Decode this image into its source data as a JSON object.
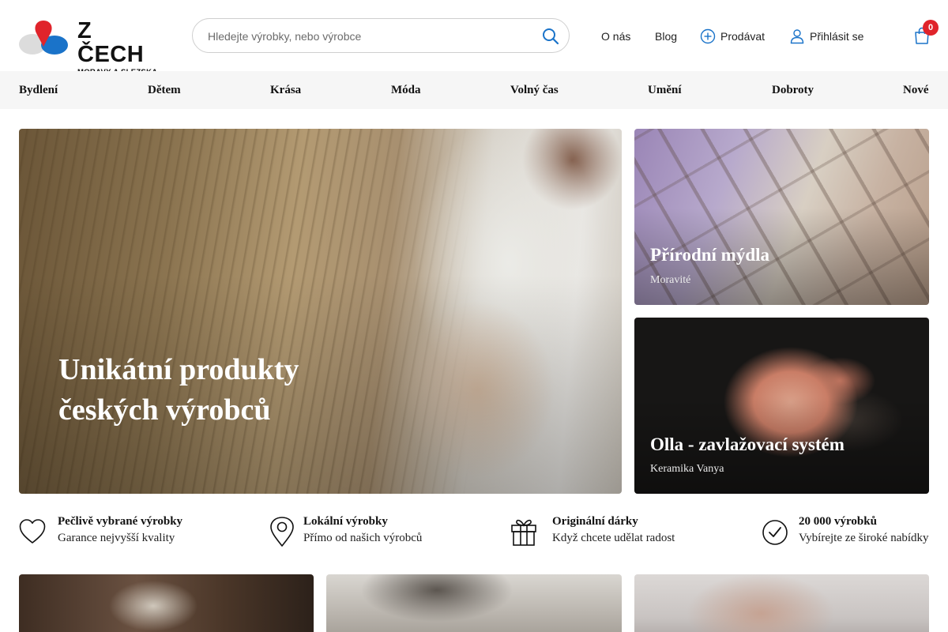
{
  "brand": {
    "title": "Z ČECH",
    "subtitle": "MORAVY A SLEZSKA"
  },
  "search": {
    "placeholder": "Hledejte výrobky, nebo výrobce"
  },
  "top_nav": {
    "about": "O nás",
    "blog": "Blog",
    "sell": "Prodávat",
    "login": "Přihlásit se"
  },
  "cart": {
    "count": "0"
  },
  "categories": [
    "Bydlení",
    "Dětem",
    "Krása",
    "Móda",
    "Volný čas",
    "Umění",
    "Dobroty",
    "Nové"
  ],
  "hero": {
    "title": "Unikátní produkty českých výrobců"
  },
  "promos": [
    {
      "title": "Přírodní mýdla",
      "subtitle": "Moravité"
    },
    {
      "title": "Olla - zavlažovací systém",
      "subtitle": "Keramika Vanya"
    }
  ],
  "features": [
    {
      "icon": "heart-icon",
      "title": "Pečlivě vybrané výrobky",
      "subtitle": "Garance nejvyšší kvality"
    },
    {
      "icon": "location-pin-icon",
      "title": "Lokální výrobky",
      "subtitle": "Přímo od našich výrobců"
    },
    {
      "icon": "gift-icon",
      "title": "Originální dárky",
      "subtitle": "Když chcete udělat radost"
    },
    {
      "icon": "check-circle-icon",
      "title": "20 000 výrobků",
      "subtitle": "Vybírejte ze široké nabídky"
    }
  ],
  "colors": {
    "accent_blue": "#1a73c9",
    "brand_red": "#e0242b",
    "text": "#111111",
    "category_bar": "#f6f6f6"
  }
}
